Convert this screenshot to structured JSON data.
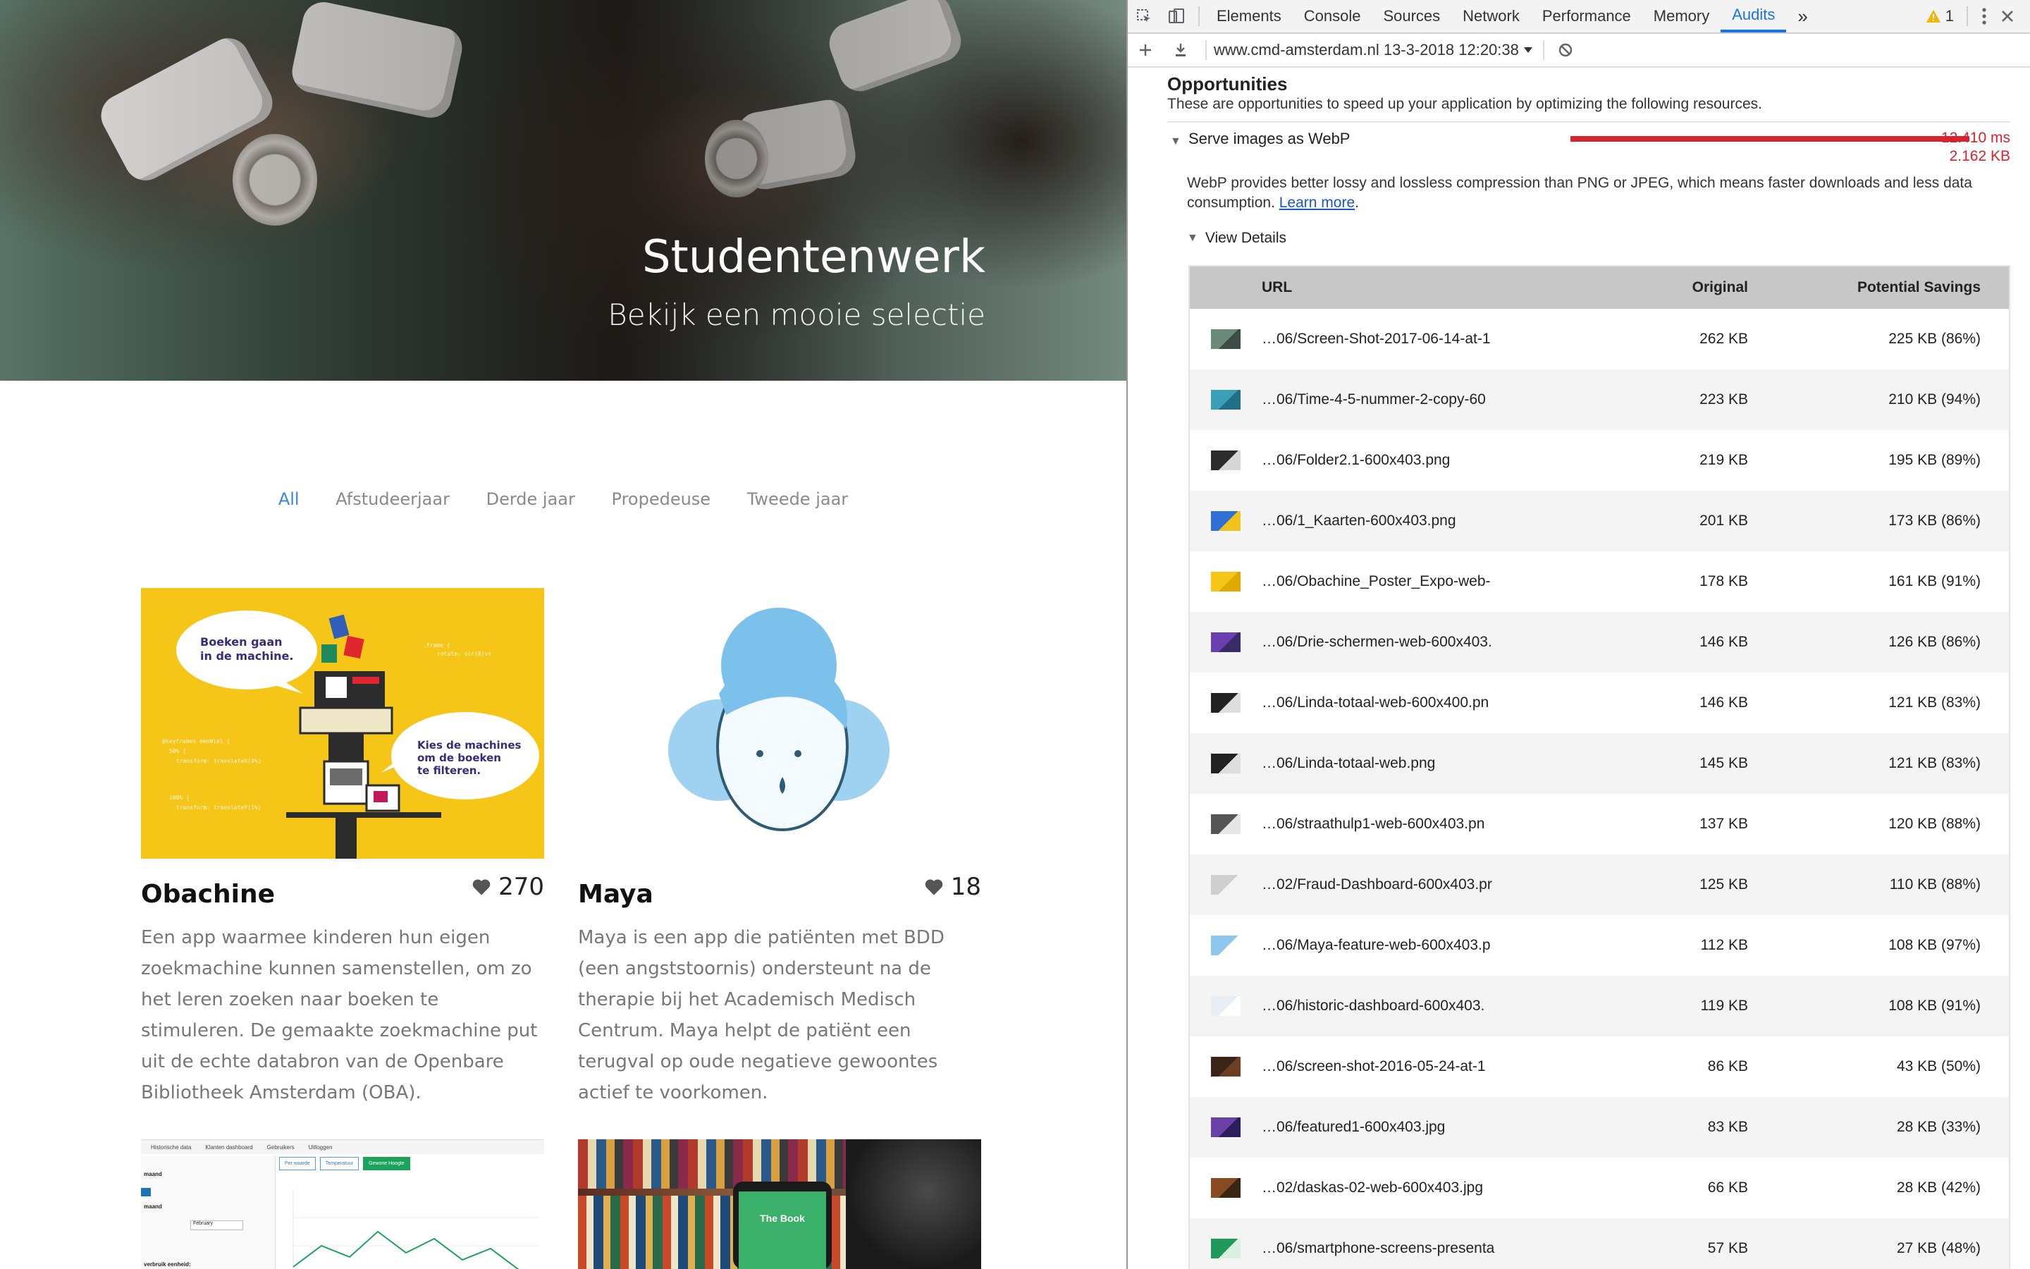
{
  "site": {
    "hero": {
      "title": "Studentenwerk",
      "subtitle": "Bekijk een mooie selectie"
    },
    "filters": [
      "All",
      "Afstudeerjaar",
      "Derde jaar",
      "Propedeuse",
      "Tweede jaar"
    ],
    "active_filter": "All",
    "cards": [
      {
        "name": "Obachine",
        "likes": "270",
        "description": "Een app waarmee kinderen hun eigen zoekmachine kunnen samenstellen, om zo het leren zoeken naar boeken te stimuleren. De gemaakte zoekmachine put uit de echte databron van de Openbare Bibliotheek Amsterdam (OBA).",
        "image_text_1": "Boeken gaan in de machine.",
        "image_text_2": "Kies de machines om de boeken te filteren."
      },
      {
        "name": "Maya",
        "likes": "18",
        "description": "Maya is een app die patiënten met BDD (een angststoornis) ondersteunt na de therapie bij het Academisch Medisch Centrum. Maya helpt de patiënt een terugval op oude negatieve gewoontes actief te voorkomen."
      }
    ],
    "dashboard_tabs": [
      "Historische data",
      "Klanten dashboard",
      "Gebruikers",
      "Uitloggen"
    ],
    "dashboard_buttons": [
      "Per waarde",
      "Temperatuur",
      "Gewone Hoogte"
    ],
    "dashboard_labels": [
      "maand",
      "maand",
      "February",
      "verbruik eenheid:"
    ],
    "book_label": "The Book"
  },
  "devtools": {
    "tabs": [
      "Elements",
      "Console",
      "Sources",
      "Network",
      "Performance",
      "Memory",
      "Audits"
    ],
    "active_tab": "Audits",
    "more_tabs": "»",
    "warning_count": "1",
    "report": "www.cmd-amsterdam.nl 13-3-2018 12:20:38",
    "opportunities": {
      "title": "Opportunities",
      "description": "These are opportunities to speed up your application by optimizing the following resources.",
      "item": {
        "label": "Serve images as WebP",
        "time": "12.410 ms",
        "size": "2.162 KB",
        "desc_prefix": "WebP provides better lossy and lossless compression than PNG or JPEG, which means faster downloads and less data consumption.",
        "learn_more": "Learn more",
        "desc_suffix": ".",
        "view_details": "View Details"
      }
    },
    "table": {
      "headers": {
        "url": "URL",
        "original": "Original",
        "savings": "Potential Savings"
      },
      "rows": [
        {
          "url": "…06/Screen-Shot-2017-06-14-at-1",
          "original": "262 KB",
          "savings": "225 KB (86%)",
          "thumb": [
            "#6a8a7a",
            "#3d4d46"
          ]
        },
        {
          "url": "…06/Time-4-5-nummer-2-copy-60",
          "original": "223 KB",
          "savings": "210 KB (94%)",
          "thumb": [
            "#3aa0b8",
            "#1f6f85"
          ]
        },
        {
          "url": "…06/Folder2.1-600x403.png",
          "original": "219 KB",
          "savings": "195 KB (89%)",
          "thumb": [
            "#2c2c2c",
            "#d6d6d6"
          ]
        },
        {
          "url": "…06/1_Kaarten-600x403.png",
          "original": "201 KB",
          "savings": "173 KB (86%)",
          "thumb": [
            "#2f6fd6",
            "#f2c21a"
          ]
        },
        {
          "url": "…06/Obachine_Poster_Expo-web-",
          "original": "178 KB",
          "savings": "161 KB (91%)",
          "thumb": [
            "#f5c518",
            "#e0a800"
          ]
        },
        {
          "url": "…06/Drie-schermen-web-600x403.",
          "original": "146 KB",
          "savings": "126 KB (86%)",
          "thumb": [
            "#6b3fb0",
            "#3a2a6a"
          ]
        },
        {
          "url": "…06/Linda-totaal-web-600x400.pn",
          "original": "146 KB",
          "savings": "121 KB (83%)",
          "thumb": [
            "#222222",
            "#dddddd"
          ]
        },
        {
          "url": "…06/Linda-totaal-web.png",
          "original": "145 KB",
          "savings": "121 KB (83%)",
          "thumb": [
            "#222222",
            "#dddddd"
          ]
        },
        {
          "url": "…06/straathulp1-web-600x403.pn",
          "original": "137 KB",
          "savings": "120 KB (88%)",
          "thumb": [
            "#555555",
            "#e6e6e6"
          ]
        },
        {
          "url": "…02/Fraud-Dashboard-600x403.pr",
          "original": "125 KB",
          "savings": "110 KB (88%)",
          "thumb": [
            "#cfcfcf",
            "#f4f4f4"
          ]
        },
        {
          "url": "…06/Maya-feature-web-600x403.p",
          "original": "112 KB",
          "savings": "108 KB (97%)",
          "thumb": [
            "#8ec8ef",
            "#ffffff"
          ]
        },
        {
          "url": "…06/historic-dashboard-600x403.",
          "original": "119 KB",
          "savings": "108 KB (91%)",
          "thumb": [
            "#e8eef4",
            "#ffffff"
          ]
        },
        {
          "url": "…06/screen-shot-2016-05-24-at-1",
          "original": "86 KB",
          "savings": "43 KB (50%)",
          "thumb": [
            "#3a2418",
            "#6e3e22"
          ]
        },
        {
          "url": "…06/featured1-600x403.jpg",
          "original": "83 KB",
          "savings": "28 KB (33%)",
          "thumb": [
            "#6a3fa8",
            "#2a1f5c"
          ]
        },
        {
          "url": "…02/daskas-02-web-600x403.jpg",
          "original": "66 KB",
          "savings": "28 KB (42%)",
          "thumb": [
            "#8a4a22",
            "#3a2414"
          ]
        },
        {
          "url": "…06/smartphone-screens-presenta",
          "original": "57 KB",
          "savings": "27 KB (48%)",
          "thumb": [
            "#1f9a5a",
            "#d8f0e0"
          ]
        }
      ]
    }
  }
}
